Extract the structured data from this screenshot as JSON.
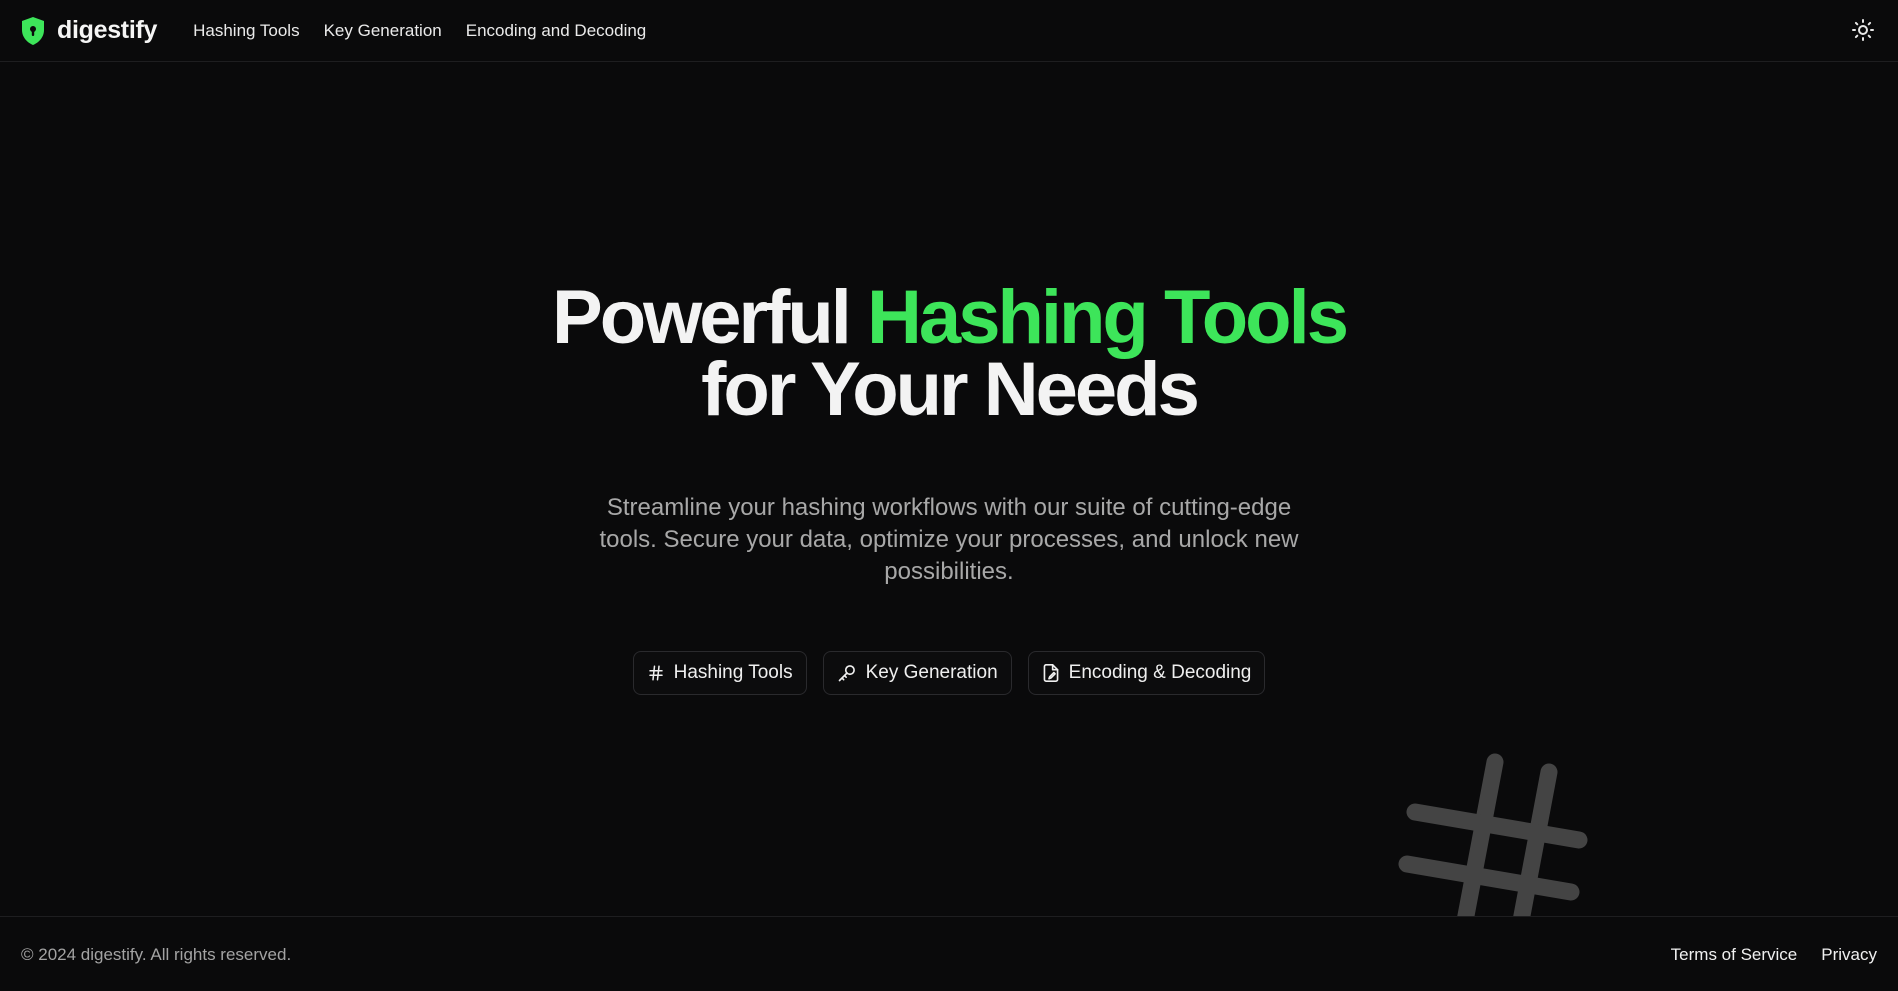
{
  "header": {
    "brand_name": "digestify",
    "nav": [
      {
        "label": "Hashing Tools"
      },
      {
        "label": "Key Generation"
      },
      {
        "label": "Encoding and Decoding"
      }
    ],
    "theme_icon": "sun-icon"
  },
  "hero": {
    "title_part1": "Powerful ",
    "title_accent": "Hashing Tools",
    "title_part2": "for Your Needs",
    "subtitle": "Streamline your hashing workflows with our suite of cutting-edge tools. Secure your data, optimize your processes, and unlock new possibilities."
  },
  "ctas": [
    {
      "label": "Hashing Tools",
      "icon": "hash-icon"
    },
    {
      "label": "Key Generation",
      "icon": "key-icon"
    },
    {
      "label": "Encoding & Decoding",
      "icon": "file-edit-icon"
    }
  ],
  "footer": {
    "copyright": "© 2024 digestify. All rights reserved.",
    "links": [
      {
        "label": "Terms of Service"
      },
      {
        "label": "Privacy"
      }
    ]
  },
  "colors": {
    "background": "#0a0a0b",
    "accent": "#3de55a",
    "text": "#f3f3f3",
    "muted": "#a8a8a8",
    "decoration": "#444444"
  }
}
